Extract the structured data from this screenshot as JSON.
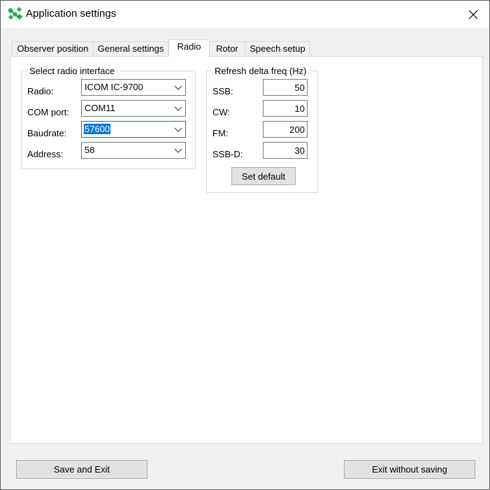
{
  "window": {
    "title": "Application settings",
    "close_symbol": "✕"
  },
  "tabs": [
    {
      "label": "Observer position",
      "active": false
    },
    {
      "label": "General settings",
      "active": false
    },
    {
      "label": "Radio",
      "active": true
    },
    {
      "label": "Rotor",
      "active": false
    },
    {
      "label": "Speech setup",
      "active": false
    }
  ],
  "radio_interface": {
    "title": "Select radio interface",
    "fields": [
      {
        "label": "Radio:",
        "value": "ICOM IC-9700"
      },
      {
        "label": "COM port:",
        "value": "COM11"
      },
      {
        "label": "Baudrate:",
        "value": "57600"
      },
      {
        "label": "Address:",
        "value": "58"
      }
    ]
  },
  "refresh_delta": {
    "title": "Refresh delta freq (Hz)",
    "fields": [
      {
        "label": "SSB:",
        "value": "50"
      },
      {
        "label": "CW:",
        "value": "10"
      },
      {
        "label": "FM:",
        "value": "200"
      },
      {
        "label": "SSB-D:",
        "value": "30"
      }
    ],
    "default_button": "Set default"
  },
  "footer": {
    "save_button": "Save and Exit",
    "exit_button": "Exit without saving"
  },
  "colors": {
    "accent": "#0078d7",
    "icon_green": "#22b14c"
  },
  "icons": {
    "app": "satellite-icon",
    "close": "close-icon",
    "dropdown": "chevron-down-icon"
  }
}
